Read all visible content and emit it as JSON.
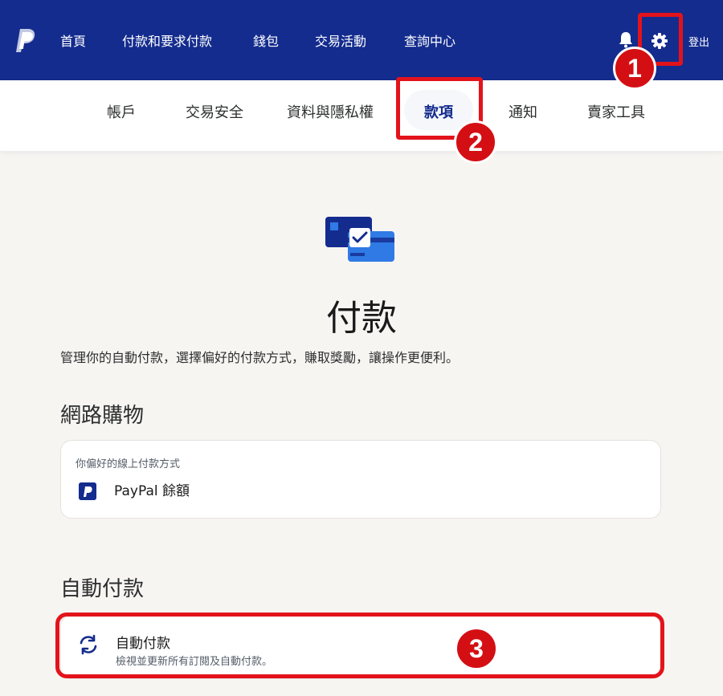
{
  "topnav": {
    "items": [
      "首頁",
      "付款和要求付款",
      "錢包",
      "交易活動",
      "查詢中心"
    ],
    "logout": "登出",
    "brand_color": "#142c8e"
  },
  "subnav": {
    "items": [
      "帳戶",
      "交易安全",
      "資料與隱私權",
      "款項",
      "通知",
      "賣家工具"
    ],
    "active": "款項"
  },
  "annotations": [
    "1",
    "2",
    "3"
  ],
  "page": {
    "title": "付款",
    "description": "管理你的自動付款，選擇偏好的付款方式，賺取獎勵，讓操作更便利。"
  },
  "online_shopping": {
    "heading": "網路購物",
    "label": "你偏好的線上付款方式",
    "method": "PayPal 餘額"
  },
  "auto_payments": {
    "heading": "自動付款",
    "title": "自動付款",
    "subtitle": "檢視並更新所有訂閱及自動付款。"
  },
  "icons": [
    "paypal-logo",
    "bell-icon",
    "gear-icon",
    "card-check-icon",
    "refresh-icon"
  ],
  "colors": {
    "annotation_red": "#e3131b",
    "accent": "#142c8e"
  }
}
